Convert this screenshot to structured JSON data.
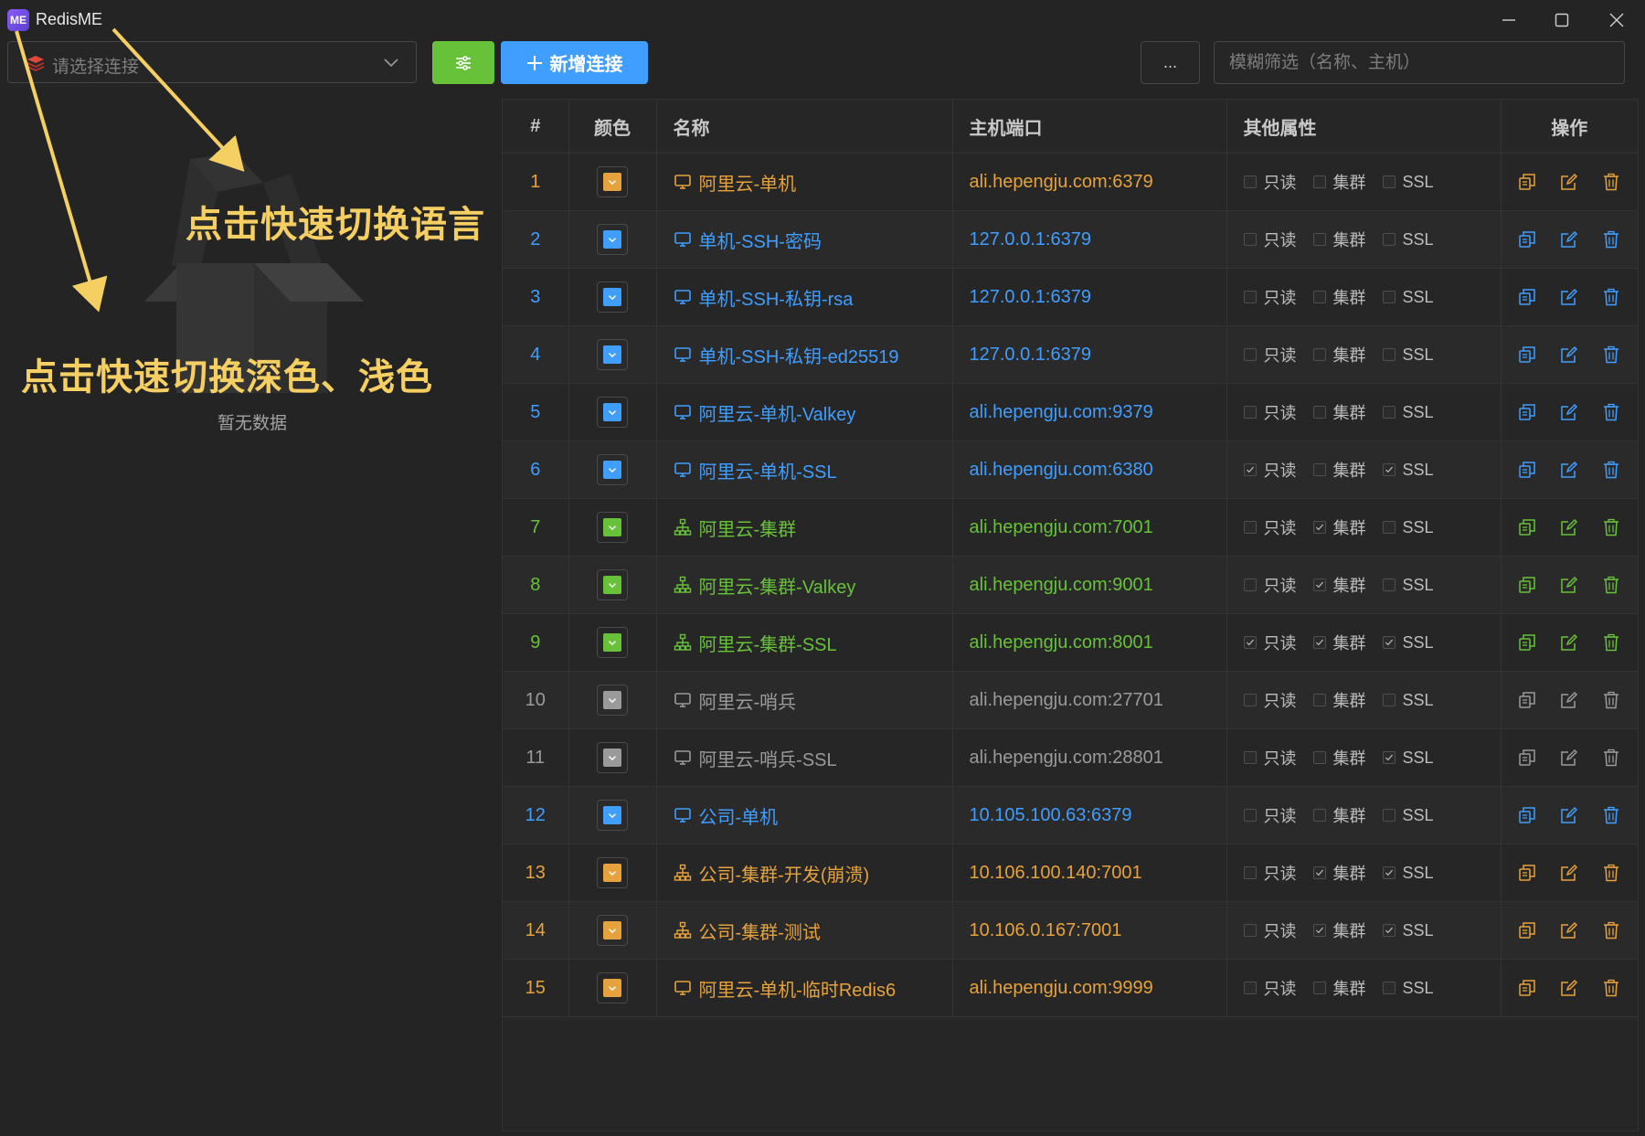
{
  "app": {
    "logo_text": "ME",
    "title": "RedisME"
  },
  "sidebar": {
    "connection_select_placeholder": "请选择连接",
    "empty_text": "暂无数据"
  },
  "toolbar": {
    "new_connection_label": "新增连接",
    "more_label": "...",
    "filter_placeholder": "模糊筛选（名称、主机）"
  },
  "annotations": {
    "language_tip": "点击快速切换语言",
    "theme_tip": "点击快速切换深色、浅色",
    "arrow_color": "#f5cf62"
  },
  "colors": {
    "orange": "#e6a23c",
    "blue": "#409eff",
    "green": "#67c23a",
    "gray": "#9a9a9a",
    "settings_button": "#67c23a",
    "new_button": "#409eff"
  },
  "table": {
    "headers": {
      "index": "#",
      "color": "颜色",
      "name": "名称",
      "host": "主机端口",
      "attrs": "其他属性",
      "actions": "操作"
    },
    "attr_labels": {
      "readonly": "只读",
      "cluster": "集群",
      "ssl": "SSL"
    },
    "rows": [
      {
        "index": "1",
        "color": "orange",
        "type": "standalone",
        "name": "阿里云-单机",
        "host": "ali.hepengju.com:6379",
        "readonly": false,
        "cluster": false,
        "ssl": false
      },
      {
        "index": "2",
        "color": "blue",
        "type": "standalone",
        "name": "单机-SSH-密码",
        "host": "127.0.0.1:6379",
        "readonly": false,
        "cluster": false,
        "ssl": false
      },
      {
        "index": "3",
        "color": "blue",
        "type": "standalone",
        "name": "单机-SSH-私钥-rsa",
        "host": "127.0.0.1:6379",
        "readonly": false,
        "cluster": false,
        "ssl": false
      },
      {
        "index": "4",
        "color": "blue",
        "type": "standalone",
        "name": "单机-SSH-私钥-ed25519",
        "host": "127.0.0.1:6379",
        "readonly": false,
        "cluster": false,
        "ssl": false
      },
      {
        "index": "5",
        "color": "blue",
        "type": "standalone",
        "name": "阿里云-单机-Valkey",
        "host": "ali.hepengju.com:9379",
        "readonly": false,
        "cluster": false,
        "ssl": false
      },
      {
        "index": "6",
        "color": "blue",
        "type": "standalone",
        "name": "阿里云-单机-SSL",
        "host": "ali.hepengju.com:6380",
        "readonly": true,
        "cluster": false,
        "ssl": true
      },
      {
        "index": "7",
        "color": "green",
        "type": "cluster",
        "name": "阿里云-集群",
        "host": "ali.hepengju.com:7001",
        "readonly": false,
        "cluster": true,
        "ssl": false
      },
      {
        "index": "8",
        "color": "green",
        "type": "cluster",
        "name": "阿里云-集群-Valkey",
        "host": "ali.hepengju.com:9001",
        "readonly": false,
        "cluster": true,
        "ssl": false
      },
      {
        "index": "9",
        "color": "green",
        "type": "cluster",
        "name": "阿里云-集群-SSL",
        "host": "ali.hepengju.com:8001",
        "readonly": true,
        "cluster": true,
        "ssl": true
      },
      {
        "index": "10",
        "color": "gray",
        "type": "standalone",
        "name": "阿里云-哨兵",
        "host": "ali.hepengju.com:27701",
        "readonly": false,
        "cluster": false,
        "ssl": false
      },
      {
        "index": "11",
        "color": "gray",
        "type": "standalone",
        "name": "阿里云-哨兵-SSL",
        "host": "ali.hepengju.com:28801",
        "readonly": false,
        "cluster": false,
        "ssl": true
      },
      {
        "index": "12",
        "color": "blue",
        "type": "standalone",
        "name": "公司-单机",
        "host": "10.105.100.63:6379",
        "readonly": false,
        "cluster": false,
        "ssl": false
      },
      {
        "index": "13",
        "color": "orange",
        "type": "cluster",
        "name": "公司-集群-开发(崩溃)",
        "host": "10.106.100.140:7001",
        "readonly": false,
        "cluster": true,
        "ssl": true
      },
      {
        "index": "14",
        "color": "orange",
        "type": "cluster",
        "name": "公司-集群-测试",
        "host": "10.106.0.167:7001",
        "readonly": false,
        "cluster": true,
        "ssl": true
      },
      {
        "index": "15",
        "color": "orange",
        "type": "standalone",
        "name": "阿里云-单机-临时Redis6",
        "host": "ali.hepengju.com:9999",
        "readonly": false,
        "cluster": false,
        "ssl": false
      }
    ]
  }
}
